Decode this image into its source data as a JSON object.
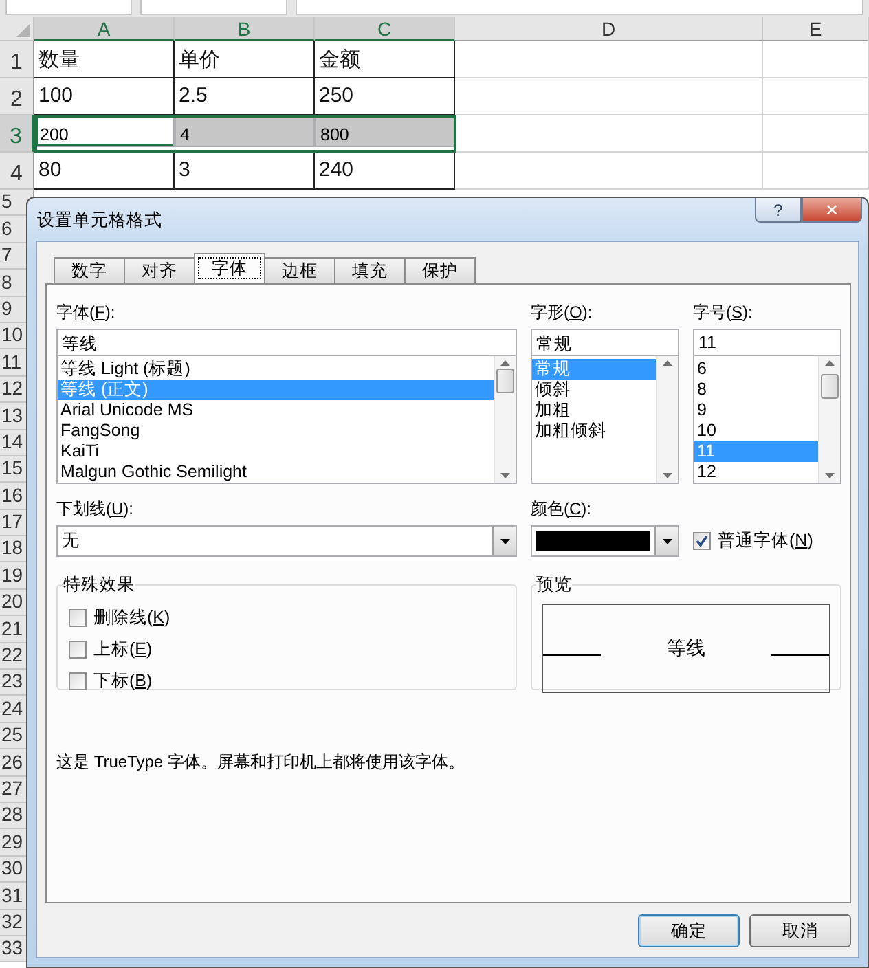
{
  "spreadsheet": {
    "columns": [
      {
        "label": "A",
        "selected": true
      },
      {
        "label": "B",
        "selected": true
      },
      {
        "label": "C",
        "selected": true
      },
      {
        "label": "D",
        "selected": false
      },
      {
        "label": "E",
        "selected": false
      }
    ],
    "rows": [
      {
        "header": "1",
        "selected": false,
        "cells": [
          {
            "text": "数量",
            "selected": false,
            "active": false
          },
          {
            "text": "单价",
            "selected": false,
            "active": false
          },
          {
            "text": "金额",
            "selected": false,
            "active": false
          }
        ]
      },
      {
        "header": "2",
        "selected": false,
        "cells": [
          {
            "text": "100",
            "selected": false,
            "active": false
          },
          {
            "text": "2.5",
            "selected": false,
            "active": false
          },
          {
            "text": "250",
            "selected": false,
            "active": false
          }
        ]
      },
      {
        "header": "3",
        "selected": true,
        "cells": [
          {
            "text": "200",
            "selected": true,
            "active": true
          },
          {
            "text": "4",
            "selected": true,
            "active": false
          },
          {
            "text": "800",
            "selected": true,
            "active": false
          }
        ]
      },
      {
        "header": "4",
        "selected": false,
        "cells": [
          {
            "text": "80",
            "selected": false,
            "active": false
          },
          {
            "text": "3",
            "selected": false,
            "active": false
          },
          {
            "text": "240",
            "selected": false,
            "active": false
          }
        ]
      }
    ],
    "more_row_headers": [
      "5",
      "6",
      "7",
      "8",
      "9",
      "10",
      "11",
      "12",
      "13",
      "14",
      "15",
      "16",
      "17",
      "18",
      "19",
      "20",
      "21",
      "22",
      "23",
      "24",
      "25",
      "26",
      "27",
      "28",
      "29",
      "30",
      "31",
      "32",
      "33"
    ]
  },
  "dialog": {
    "title": "设置单元格格式",
    "title_buttons": [
      {
        "kind": "help",
        "glyph": "?"
      },
      {
        "kind": "close",
        "glyph": "✕"
      }
    ],
    "tabs": [
      {
        "label": "数字",
        "selected": false
      },
      {
        "label": "对齐",
        "selected": false
      },
      {
        "label": "字体",
        "selected": true
      },
      {
        "label": "边框",
        "selected": false
      },
      {
        "label": "填充",
        "selected": false
      },
      {
        "label": "保护",
        "selected": false
      }
    ],
    "font": {
      "label": "字体(F):",
      "value": "等线",
      "items": [
        {
          "text": "等线 Light (标题)",
          "selected": false
        },
        {
          "text": "等线 (正文)",
          "selected": true
        },
        {
          "text": "Arial Unicode MS",
          "selected": false
        },
        {
          "text": "FangSong",
          "selected": false
        },
        {
          "text": "KaiTi",
          "selected": false
        },
        {
          "text": "Malgun Gothic Semilight",
          "selected": false
        }
      ]
    },
    "style": {
      "label": "字形(O):",
      "value": "常规",
      "items": [
        {
          "text": "常规",
          "selected": true
        },
        {
          "text": "倾斜",
          "selected": false
        },
        {
          "text": "加粗",
          "selected": false
        },
        {
          "text": "加粗倾斜",
          "selected": false
        }
      ]
    },
    "size": {
      "label": "字号(S):",
      "value": "11",
      "items": [
        {
          "text": "6",
          "selected": false
        },
        {
          "text": "8",
          "selected": false
        },
        {
          "text": "9",
          "selected": false
        },
        {
          "text": "10",
          "selected": false
        },
        {
          "text": "11",
          "selected": true
        },
        {
          "text": "12",
          "selected": false
        }
      ]
    },
    "underline": {
      "label": "下划线(U):",
      "value": "无"
    },
    "color": {
      "label": "颜色(C):",
      "color": "#000000"
    },
    "normal_font": {
      "label": "普通字体(N)",
      "checked": true
    },
    "effects": {
      "title": "特殊效果",
      "items": [
        {
          "label": "删除线(K)",
          "checked": false
        },
        {
          "label": "上标(E)",
          "checked": false
        },
        {
          "label": "下标(B)",
          "checked": false
        }
      ]
    },
    "preview": {
      "title": "预览",
      "sample": "等线"
    },
    "description": "这是 TrueType 字体。屏幕和打印机上都将使用该字体。",
    "buttons": [
      {
        "label": "确定",
        "default": true
      },
      {
        "label": "取消",
        "default": false
      }
    ]
  }
}
